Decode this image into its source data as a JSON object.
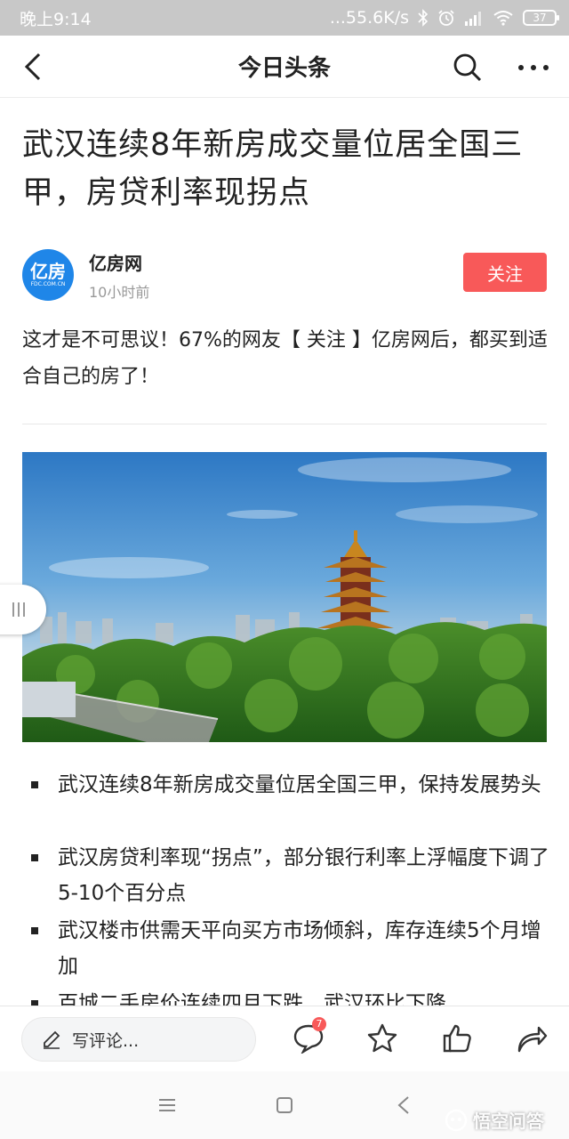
{
  "status_bar": {
    "time": "晚上9:14",
    "network_speed": "...55.6K/s",
    "battery": "37"
  },
  "header": {
    "title": "今日头条"
  },
  "article": {
    "headline": "武汉连续8年新房成交量位居全国三甲，房贷利率现拐点",
    "author": {
      "name": "亿房网",
      "time": "10小时前",
      "avatar_text": "亿房",
      "avatar_subtext": "FDC.COM.CN"
    },
    "follow_label": "关注",
    "promo_text": "这才是不可思议！67%的网友【 关注 】亿房网后，都买到适合自己的房了！",
    "bullets": [
      "武汉连续8年新房成交量位居全国三甲，保持发展势头",
      "武汉房贷利率现“拐点”，部分银行利率上浮幅度下调了5-10个百分点",
      "武汉楼市供需天平向买方市场倾斜，库存连续5个月增加",
      "百城二手房价连续四月下跌，武汉环比下降"
    ]
  },
  "action_bar": {
    "comment_placeholder": "写评论...",
    "comment_count": "7"
  },
  "watermark": "悟空问答",
  "colors": {
    "accent": "#f85959",
    "avatar": "#1f86e8",
    "status_bar": "#c8c8c8"
  }
}
